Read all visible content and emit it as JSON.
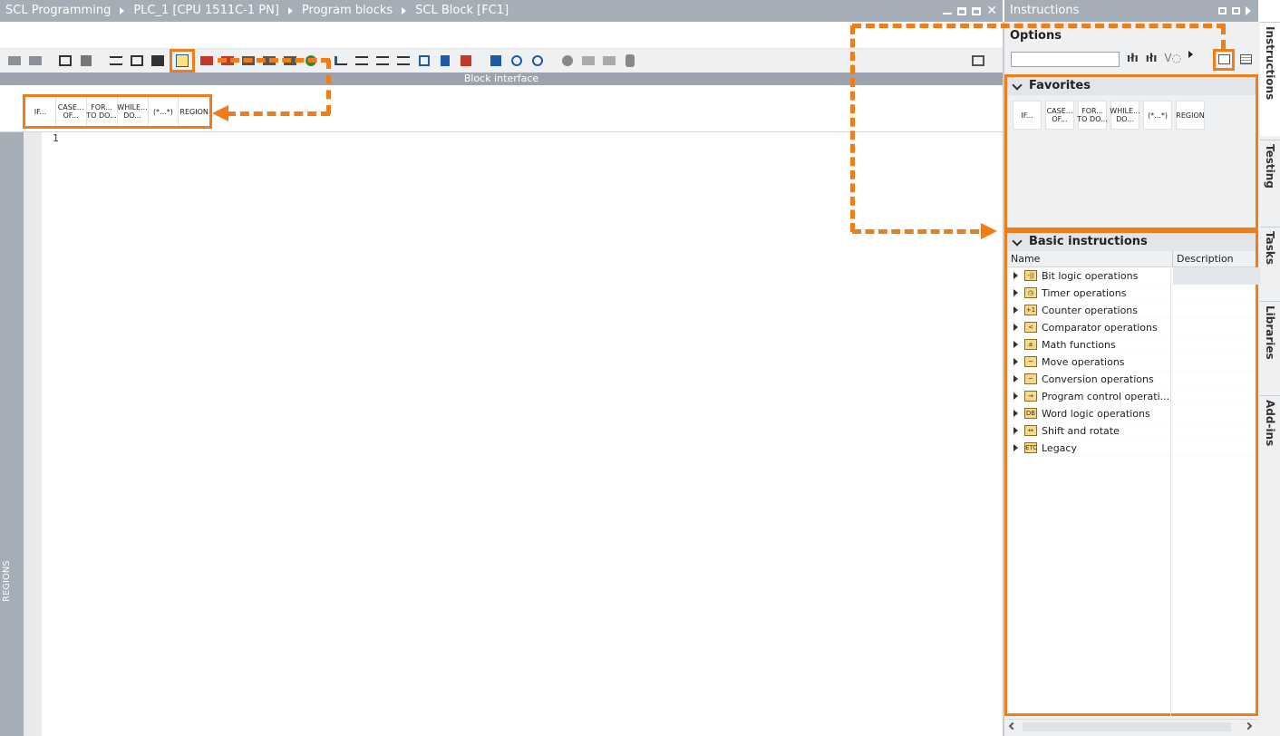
{
  "titlebar": {
    "crumbs": [
      "SCL Programming",
      "PLC_1 [CPU 1511C-1 PN]",
      "Program blocks",
      "SCL Block [FC1]"
    ]
  },
  "right_panel": {
    "title": "Instructions",
    "options_label": "Options",
    "search": {
      "value": "",
      "placeholder": ""
    },
    "favorites_title": "Favorites",
    "basic_title": "Basic instructions",
    "col_name": "Name",
    "col_desc": "Description",
    "items": [
      {
        "label": "Bit logic operations",
        "icon": "-||"
      },
      {
        "label": "Timer operations",
        "icon": "◷"
      },
      {
        "label": "Counter operations",
        "icon": "+1"
      },
      {
        "label": "Comparator operations",
        "icon": "<"
      },
      {
        "label": "Math functions",
        "icon": "±"
      },
      {
        "label": "Move operations",
        "icon": "~"
      },
      {
        "label": "Conversion operations",
        "icon": "~"
      },
      {
        "label": "Program control operati...",
        "icon": "→"
      },
      {
        "label": "Word logic operations",
        "icon": "DB"
      },
      {
        "label": "Shift and rotate",
        "icon": "↔"
      },
      {
        "label": "Legacy",
        "icon": "ETC"
      }
    ]
  },
  "snippets": [
    "IF...",
    "CASE...\nOF...",
    "FOR...\nTO DO...",
    "WHILE...\nDO...",
    "(*...*)",
    "REGION"
  ],
  "editor": {
    "block_interface": "Block interface",
    "line1": "1",
    "regions_label": "REGIONS"
  },
  "vtabs": [
    "Instructions",
    "Testing",
    "Tasks",
    "Libraries",
    "Add-ins"
  ],
  "colors": {
    "accent": "#f07d1b",
    "titlebar": "#a5adb6"
  }
}
